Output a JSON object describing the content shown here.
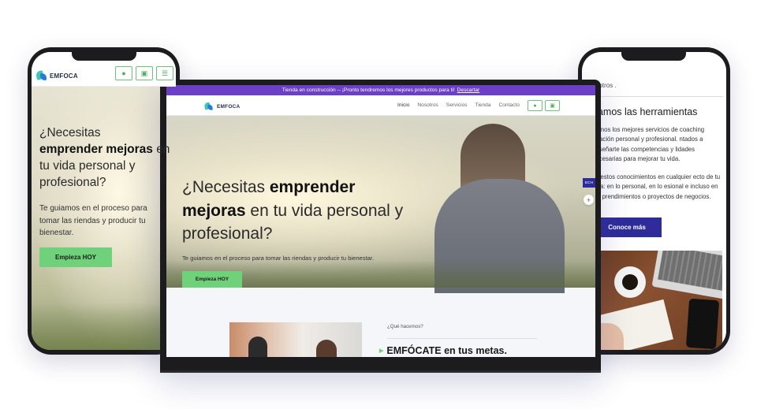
{
  "brand": {
    "name": "EMFOCA"
  },
  "colors": {
    "accent_green": "#6fd27a",
    "brand_navy": "#2e2c9b",
    "announce_purple": "#6b3fc6"
  },
  "icons": {
    "user": "user-icon",
    "bag": "bag-icon",
    "menu": "menu-icon",
    "plus": "plus-icon"
  },
  "left_phone": {
    "headline_pre": "¿Necesitas",
    "headline_bold": "emprender mejoras",
    "headline_post": "en tu vida personal y profesional?",
    "subtitle": "Te guiamos en el proceso para tomar las riendas y producir tu bienestar.",
    "cta": "Empieza HOY"
  },
  "laptop": {
    "announcement": "Tienda en construcción -- ¡Pronto tendremos los mejores productos para ti!",
    "announcement_link": "Descartar",
    "nav": [
      "Inicio",
      "Nosotros",
      "Servicios",
      "Tienda",
      "Contacto"
    ],
    "headline_pre": "¿Necesitas",
    "headline_bold1": "emprender",
    "headline_bold2": "mejoras",
    "headline_post": "en tu vida personal y profesional?",
    "subtitle": "Te guiamos en el proceso para tomar las riendas y producir tu bienestar.",
    "cta": "Empieza HOY",
    "lang_badge": "ECH",
    "section_kicker": "¿Qué hacemos?",
    "section_title": "EMFÓCATE en tus metas."
  },
  "right_phone": {
    "breadcrumb": "osotros .",
    "title": "damos las herramientas",
    "paragraph1": "damos los mejores servicios de coaching rmación personal y profesional. ntados a enseñarte las competencias y lidades necesarias para mejorar tu vida.",
    "paragraph2": "ca estos conocimientos en cualquier ecto de tu vida: en lo personal, en lo esional e incluso en tus prendimientos o proyectos de negocios.",
    "cta": "Conoce más"
  }
}
